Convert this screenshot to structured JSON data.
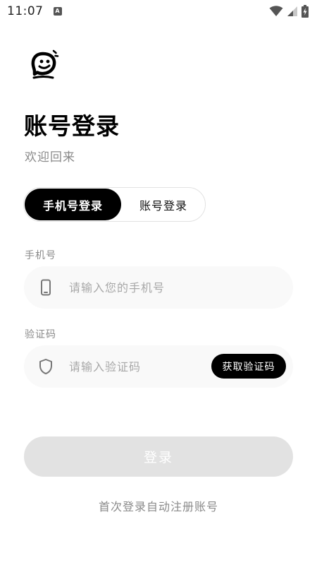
{
  "status_bar": {
    "time": "11:07",
    "notification_glyph": "A",
    "icons": [
      "wifi-icon",
      "cell-signal-icon",
      "battery-charging-icon"
    ]
  },
  "header": {
    "logo_icon": "chat-bubble-face-icon",
    "title": "账号登录",
    "subtitle": "欢迎回来"
  },
  "tabs": [
    {
      "label": "手机号登录",
      "selected": true
    },
    {
      "label": "账号登录",
      "selected": false
    }
  ],
  "phone_field": {
    "label": "手机号",
    "placeholder": "请输入您的手机号",
    "value": "",
    "icon": "phone-icon"
  },
  "code_field": {
    "label": "验证码",
    "placeholder": "请输入验证码",
    "value": "",
    "icon": "shield-icon",
    "button_label": "获取验证码"
  },
  "login_button": {
    "label": "登录",
    "enabled": false
  },
  "register_hint": "首次登录自动注册账号",
  "colors": {
    "accent": "#000000",
    "disabled_button": "#e2e2e2",
    "muted_text": "#8a8a8a",
    "field_background": "#f9f9f9"
  }
}
